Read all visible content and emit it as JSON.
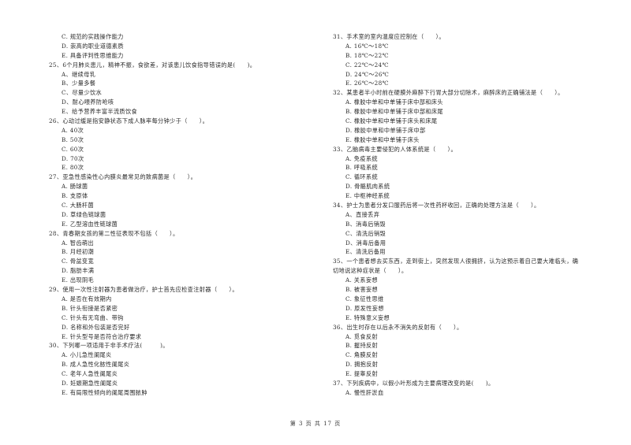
{
  "left_column": {
    "lines": [
      {
        "type": "opt",
        "text": "C. 规范的实践操作能力"
      },
      {
        "type": "opt",
        "text": "D. 崇高的职业道德素质"
      },
      {
        "type": "opt",
        "text": "E. 具备评判性思维能力"
      },
      {
        "type": "q",
        "text": "25、6个月肺炎患儿，精神不振，食欲差，对该患儿饮食指导错误的是(　　)。"
      },
      {
        "type": "opt",
        "text": "A、继续母乳"
      },
      {
        "type": "opt",
        "text": "B、少量多餐"
      },
      {
        "type": "opt",
        "text": "C、尽量少饮水"
      },
      {
        "type": "opt",
        "text": "D、耐心喂养防呛咳"
      },
      {
        "type": "opt",
        "text": "E、给予营养丰富半流质饮食"
      },
      {
        "type": "q",
        "text": "26、心动过缓是指安静状态下成人脉率每分钟少于（　　）。"
      },
      {
        "type": "opt",
        "text": "A. 40次"
      },
      {
        "type": "opt",
        "text": "B. 50次"
      },
      {
        "type": "opt",
        "text": "C. 60次"
      },
      {
        "type": "opt",
        "text": "D. 70次"
      },
      {
        "type": "opt",
        "text": "E. 80次"
      },
      {
        "type": "q",
        "text": "27、亚急性感染性心内膜炎最常见的致病菌是（　　）。"
      },
      {
        "type": "opt",
        "text": "A. 肠球菌"
      },
      {
        "type": "opt",
        "text": "B. 支原体"
      },
      {
        "type": "opt",
        "text": "C. 大肠杆菌"
      },
      {
        "type": "opt",
        "text": "D. 草绿色链球菌"
      },
      {
        "type": "opt",
        "text": "E. 乙型溶血性链球菌"
      },
      {
        "type": "q",
        "text": "28、青春期女孩的第二性征表现不包括（　　）。"
      },
      {
        "type": "opt",
        "text": "A. 智齿萌出"
      },
      {
        "type": "opt",
        "text": "B. 月经初潮"
      },
      {
        "type": "opt",
        "text": "C. 骨盆变宽"
      },
      {
        "type": "opt",
        "text": "D. 脂肪丰满"
      },
      {
        "type": "opt",
        "text": "E. 出现阴毛"
      },
      {
        "type": "q",
        "text": "29、使用一次性注射器为患者做治疗，护士首先应检查注射器（　　）。"
      },
      {
        "type": "opt",
        "text": "A. 是否在有效期内"
      },
      {
        "type": "opt",
        "text": "B. 针头衔接是否紧密"
      },
      {
        "type": "opt",
        "text": "C. 针头有无弯曲、带钩"
      },
      {
        "type": "opt",
        "text": "D. 名称和外包装是否完好"
      },
      {
        "type": "opt",
        "text": "E. 针头型号是否符合治疗要求"
      },
      {
        "type": "q",
        "text": "30、下列哪一项适用于非手术疗法(　　　)。"
      },
      {
        "type": "opt",
        "text": "A. 小儿急性阑尾炎"
      },
      {
        "type": "opt",
        "text": "B. 成人急性化脓性阑尾炎"
      },
      {
        "type": "opt",
        "text": "C. 老年人急性阑尾炎"
      },
      {
        "type": "opt",
        "text": "D. 妊娠期急性阑尾炎"
      },
      {
        "type": "opt",
        "text": "E. 有局限性倾向的阑尾周围脓肿"
      }
    ]
  },
  "right_column": {
    "lines": [
      {
        "type": "q",
        "text": "31、手术室的室内温度应控制在（　　）。"
      },
      {
        "type": "opt",
        "text": "A. 16℃～18℃"
      },
      {
        "type": "opt",
        "text": "B. 18℃～22℃"
      },
      {
        "type": "opt",
        "text": "C. 22℃～24℃"
      },
      {
        "type": "opt",
        "text": "D. 24℃～26℃"
      },
      {
        "type": "opt",
        "text": "E. 26℃～28℃"
      },
      {
        "type": "q",
        "text": "32、某患者半小时前在硬膜外麻醉下行胃大部分切除术，麻醉床的正确铺法是（　　）。"
      },
      {
        "type": "opt",
        "text": "A. 橡胶中单和中单铺于床中部和床头"
      },
      {
        "type": "opt",
        "text": "B. 橡胶中单和中单铺于床中部和床尾"
      },
      {
        "type": "opt",
        "text": "C. 橡胶中单和中单铺于床头和床尾"
      },
      {
        "type": "opt",
        "text": "D. 橡胶中单和中单铺于床中部"
      },
      {
        "type": "opt",
        "text": "E. 橡胶中单和中单铺于床头"
      },
      {
        "type": "q",
        "text": "33、乙脑病毒主要侵犯的人体系统是（　　）。"
      },
      {
        "type": "opt",
        "text": "A. 免疫系统"
      },
      {
        "type": "opt",
        "text": "B. 呼吸系统"
      },
      {
        "type": "opt",
        "text": "C. 循环系统"
      },
      {
        "type": "opt",
        "text": "D. 骨骼肌肉系统"
      },
      {
        "type": "opt",
        "text": "E. 中枢神经系统"
      },
      {
        "type": "q",
        "text": "34、护士为患者分发口服药后将一次性药杯收回，正确的处理方法是（　　）。"
      },
      {
        "type": "opt",
        "text": "A、直接丢弃"
      },
      {
        "type": "opt",
        "text": "B、消毒后销毁"
      },
      {
        "type": "opt",
        "text": "C、清洗后销毁"
      },
      {
        "type": "opt",
        "text": "D、消毒后备用"
      },
      {
        "type": "opt",
        "text": "E、清洗后备用"
      },
      {
        "type": "q",
        "text": "35、一个患者想去买东西，走到街上，突然发现人很拥挤，认为这预示着自己要大难临头，确"
      },
      {
        "type": "q",
        "text": "切地说这种症状是（　　）。"
      },
      {
        "type": "opt",
        "text": "A. 关系妄想"
      },
      {
        "type": "opt",
        "text": "B. 被害妄想"
      },
      {
        "type": "opt",
        "text": "C. 象征性思维"
      },
      {
        "type": "opt",
        "text": "D. 原发性妄想"
      },
      {
        "type": "opt",
        "text": "E. 特殊意义妄想"
      },
      {
        "type": "q",
        "text": "36、出生时存在以后永不消失的反射有（　　）。"
      },
      {
        "type": "opt",
        "text": "A. 觅食反射"
      },
      {
        "type": "opt",
        "text": "B. 握持反射"
      },
      {
        "type": "opt",
        "text": "C. 角膜反射"
      },
      {
        "type": "opt",
        "text": "D. 拥抱反射"
      },
      {
        "type": "opt",
        "text": "E. 提睾反射"
      },
      {
        "type": "q",
        "text": "37、下列疾病中，以假小叶形成为主要病理改变的是(　　)。"
      },
      {
        "type": "opt",
        "text": "A. 慢性肝淤血"
      }
    ]
  },
  "footer": {
    "page_label": "第 3 页 共 17 页"
  }
}
